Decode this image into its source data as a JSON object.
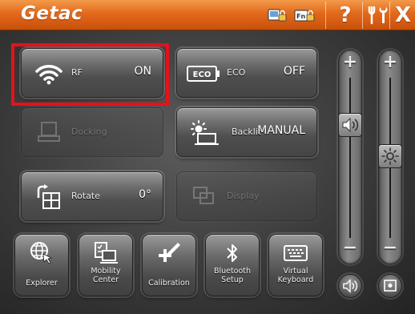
{
  "app": {
    "logo": "Getac"
  },
  "titlebar": {
    "icons": [
      "touch-lock-icon",
      "fn-lock-icon"
    ],
    "help_label": "?",
    "close_label": "X"
  },
  "panels": {
    "rf": {
      "label": "RF",
      "value": "ON",
      "icon": "wifi-icon",
      "highlighted": true
    },
    "eco": {
      "label": "ECO",
      "value": "OFF",
      "icon": "eco-icon",
      "badge": "ECO"
    },
    "docking": {
      "label": "Docking",
      "value": "",
      "icon": "docking-icon",
      "disabled": true
    },
    "backlit": {
      "label": "Backlit",
      "value": "MANUAL",
      "icon": "backlit-keyboard-icon"
    },
    "rotate": {
      "label": "Rotate",
      "value": "0°",
      "icon": "rotate-icon"
    },
    "display": {
      "label": "Display",
      "value": "",
      "icon": "display-icon",
      "disabled": true
    }
  },
  "shortcuts": [
    {
      "label": "Explorer",
      "icon": "globe-cursor-icon"
    },
    {
      "label": "Mobility\nCenter",
      "icon": "mobility-center-icon"
    },
    {
      "label": "Calibration",
      "icon": "calibration-pen-icon"
    },
    {
      "label": "Bluetooth\nSetup",
      "icon": "bluetooth-icon"
    },
    {
      "label": "Virtual\nKeyboard",
      "icon": "keyboard-icon"
    }
  ],
  "sliders": {
    "volume": {
      "plus": "+",
      "minus": "−",
      "icon": "speaker-icon",
      "level": 0.65
    },
    "brightness": {
      "plus": "+",
      "minus": "−",
      "icon": "brightness-icon",
      "level": 0.42
    }
  },
  "colors": {
    "titlebar": "#e2691c",
    "highlight": "#e3121b"
  }
}
